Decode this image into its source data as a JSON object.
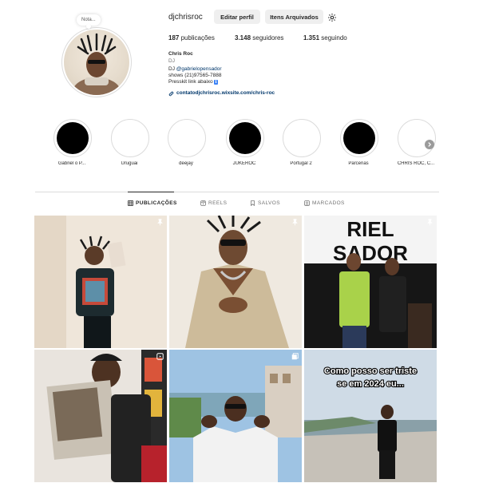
{
  "profile": {
    "username": "djchrisroc",
    "note": "Nota...",
    "edit_profile": "Editar perfil",
    "archived": "Itens Arquivados",
    "stats": {
      "posts_count": "187",
      "posts_label": "publicações",
      "followers_count": "3.148",
      "followers_label": "seguidores",
      "following_count": "1.351",
      "following_label": "seguindo"
    },
    "bio": {
      "name": "Chris Roc",
      "category": "DJ",
      "line_dj": "DJ ",
      "mention": "@gabrielopensador",
      "line_shows": "shows (21)97565-7888",
      "line_presskit": "Presskit link abaixo",
      "presskit_emoji": "ℹ",
      "link": "contatodjchrisroc.wixsite.com/chris-roc"
    }
  },
  "highlights": [
    {
      "label": "Gabriel o P...",
      "style": "black"
    },
    {
      "label": "Uruguai",
      "style": "white"
    },
    {
      "label": "deejay",
      "style": "white"
    },
    {
      "label": "JUKEROC",
      "style": "black"
    },
    {
      "label": "Portugal 2",
      "style": "white"
    },
    {
      "label": "Parcerias",
      "style": "black"
    },
    {
      "label": "CHRIS ROC, C...",
      "style": "white"
    }
  ],
  "tabs": [
    {
      "label": "PUBLICAÇÕES",
      "icon": "grid-icon",
      "active": true
    },
    {
      "label": "REELS",
      "icon": "reels-icon",
      "active": false
    },
    {
      "label": "SALVOS",
      "icon": "bookmark-icon",
      "active": false
    },
    {
      "label": "MARCADOS",
      "icon": "tagged-icon",
      "active": false
    }
  ],
  "posts": {
    "post6_caption_line1": "Como posso ser triste",
    "post6_caption_line2": "se em 2024 eu...",
    "post3_banner_top": "RIEL",
    "post3_banner_bottom": "SADOR"
  },
  "colors": {
    "link": "#00376b",
    "button_bg": "#efefef",
    "divider": "#dbdbdb",
    "text": "#262626",
    "secondary_text": "#737373"
  }
}
